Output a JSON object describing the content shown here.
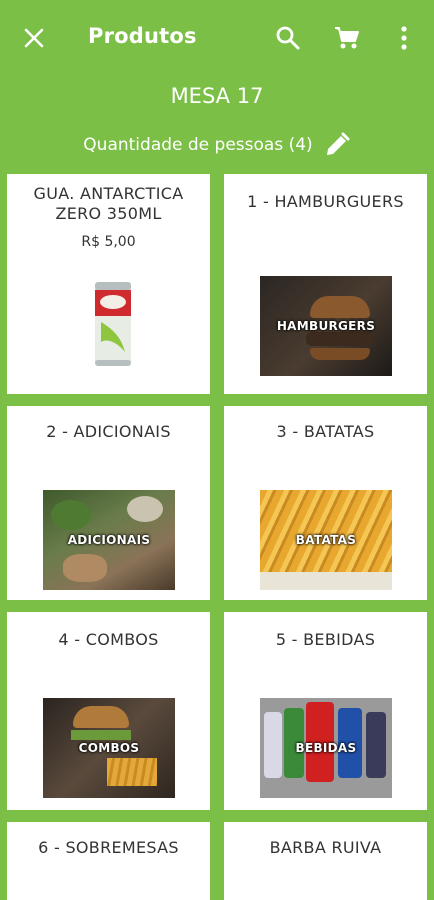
{
  "appbar": {
    "title": "Produtos"
  },
  "table": {
    "label": "MESA 17"
  },
  "people": {
    "label": "Quantidade de pessoas (4)"
  },
  "products": [
    {
      "name": "GUA. ANTARCTICA ZERO 350ML",
      "price": "R$ 5,00"
    },
    {
      "name": "1 - HAMBURGUERS",
      "image_caption": "HAMBURGERS"
    },
    {
      "name": "2 - ADICIONAIS",
      "image_caption": "ADICIONAIS"
    },
    {
      "name": "3 - BATATAS",
      "image_caption": "BATATAS"
    },
    {
      "name": "4 - COMBOS",
      "image_caption": "COMBOS"
    },
    {
      "name": "5 - BEBIDAS",
      "image_caption": "BEBIDAS"
    },
    {
      "name": "6 - SOBREMESAS"
    },
    {
      "name": "BARBA RUIVA"
    }
  ],
  "colors": {
    "brand_green": "#7cbf46",
    "card_bg": "#ffffff",
    "text": "#333333"
  },
  "icons": {
    "close": "close-icon",
    "search": "search-icon",
    "cart": "cart-icon",
    "more": "more-vert-icon",
    "edit": "pencil-icon"
  }
}
